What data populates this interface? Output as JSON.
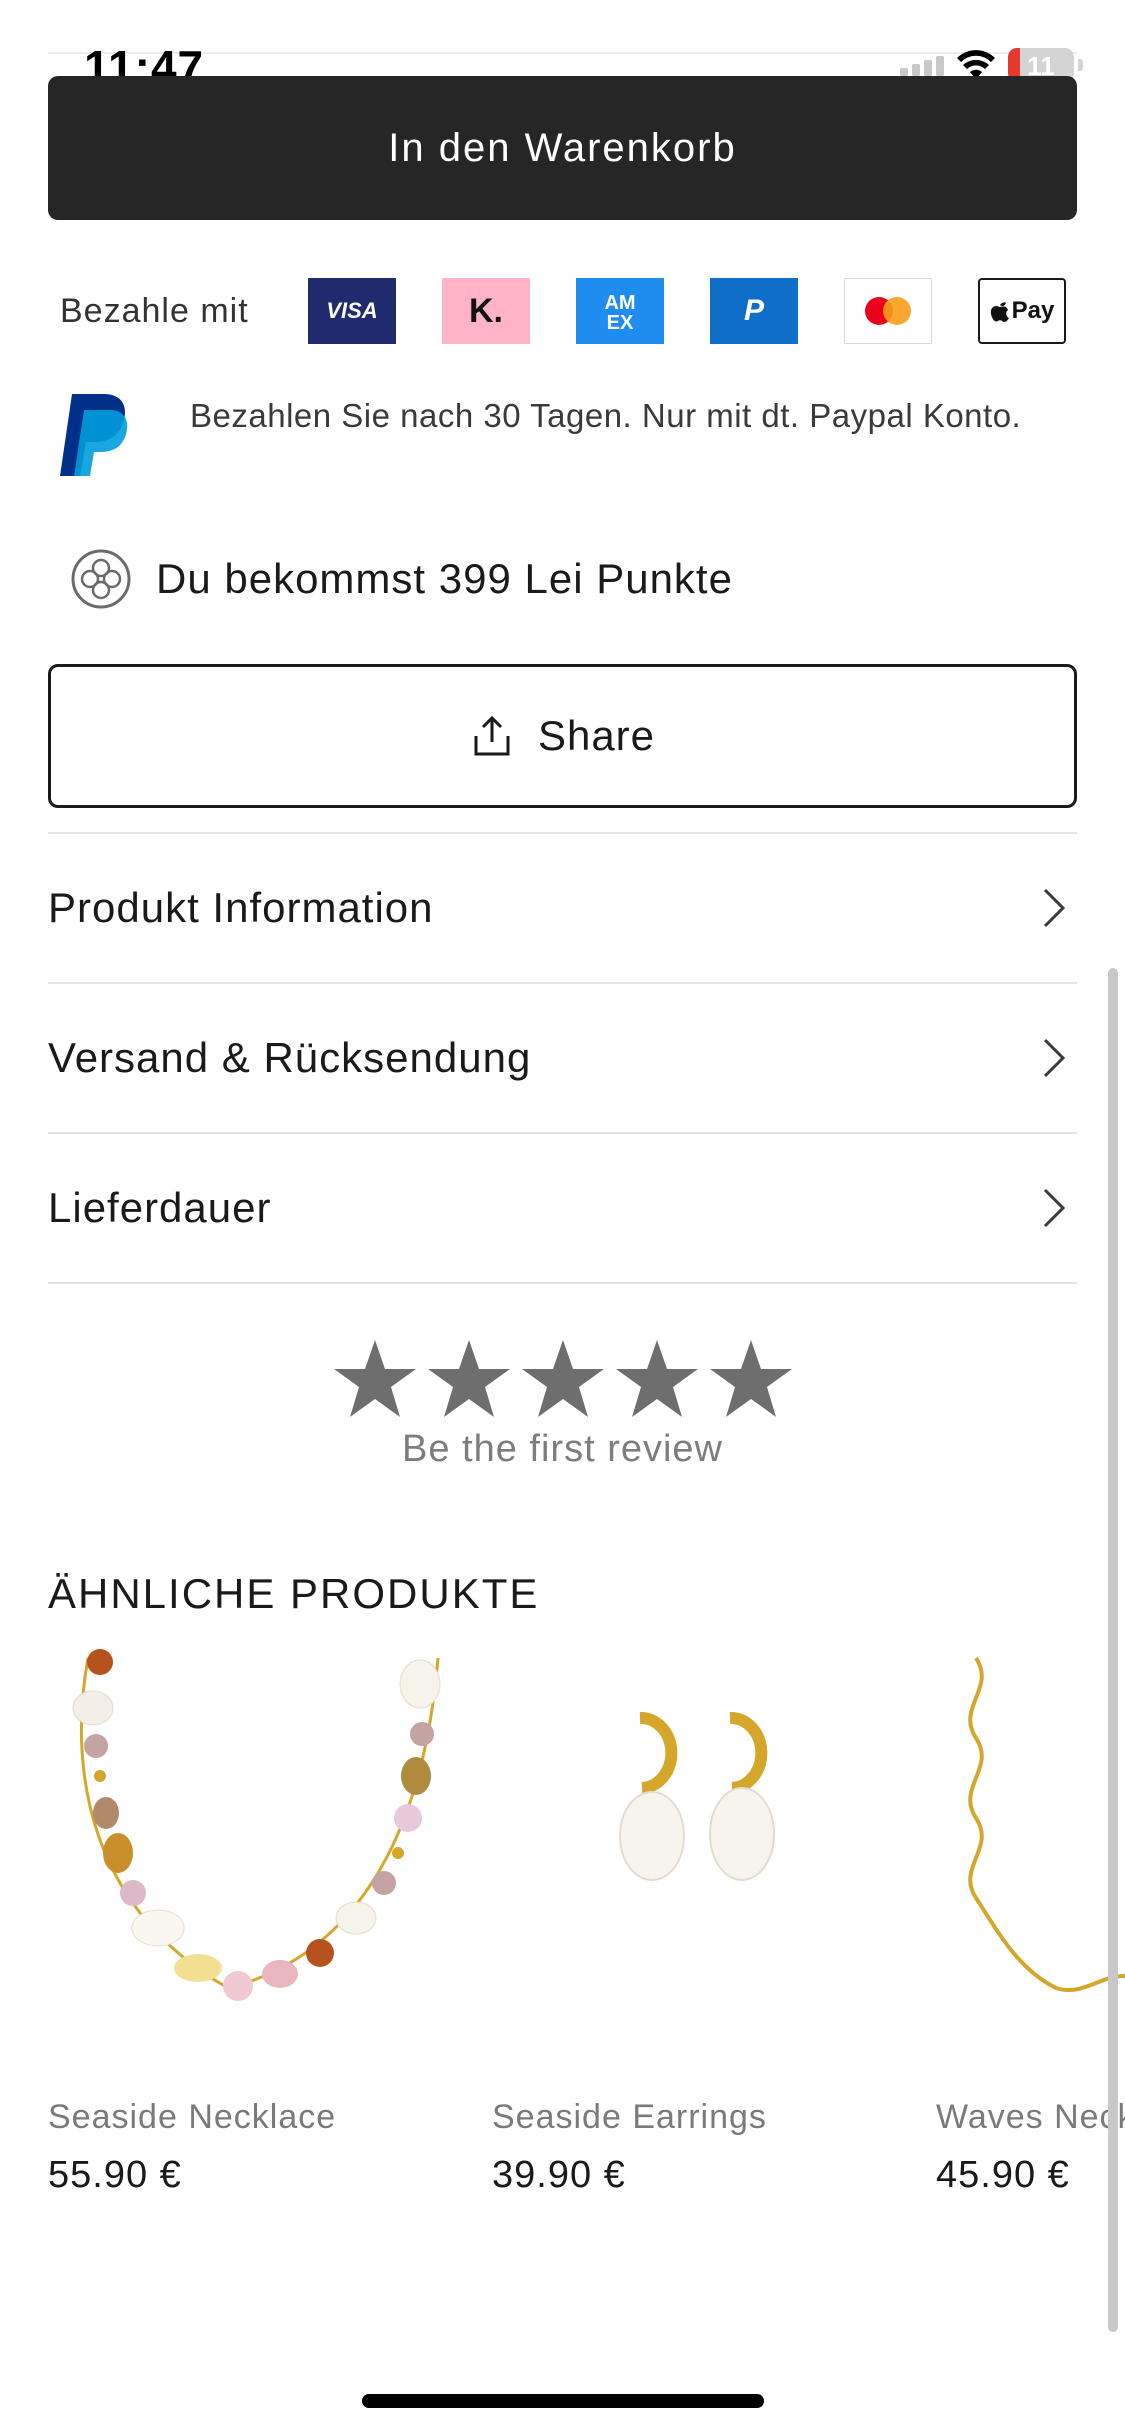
{
  "status_bar": {
    "time": "11:47",
    "battery": "11"
  },
  "cart_button": {
    "label": "In den Warenkorb"
  },
  "payment": {
    "label": "Bezahle mit",
    "methods": [
      {
        "name": "visa",
        "text": "VISA",
        "color": "#1f2b6c"
      },
      {
        "name": "klarna",
        "text": "K.",
        "color": "#ffb3c7"
      },
      {
        "name": "amex",
        "text": "AM EX",
        "color": "#1f8df0"
      },
      {
        "name": "paypal",
        "text": "P",
        "color": "#0f6fc8"
      },
      {
        "name": "mastercard",
        "text": "",
        "color": "#eb001b"
      },
      {
        "name": "apple-pay",
        "text": "Pay",
        "color": "#111111"
      }
    ]
  },
  "paypal_info": {
    "text": "Bezahlen Sie nach 30 Tagen. Nur mit dt. Paypal Konto."
  },
  "points": {
    "text": "Du bekommst 399 Lei Punkte",
    "icon": "points-icon"
  },
  "share": {
    "label": "Share",
    "icon": "share-icon"
  },
  "accordion": [
    {
      "label": "Produkt Information"
    },
    {
      "label": "Versand & Rücksendung"
    },
    {
      "label": "Lieferdauer"
    }
  ],
  "rating": {
    "stars": 5,
    "filled": 0,
    "text": "Be the first review",
    "star_color": "#6e6e6e"
  },
  "similar": {
    "title": "ÄHNLICHE PRODUKTE",
    "products": [
      {
        "name": "Seaside Necklace",
        "price": "55.90 €"
      },
      {
        "name": "Seaside Earrings",
        "price": "39.90 €"
      },
      {
        "name": "Waves Necklace",
        "price": "45.90 €"
      }
    ]
  },
  "colors": {
    "button_dark": "#262626",
    "text": "#1a1a1a",
    "muted": "#7a7a7a",
    "gold": "#d4a62a"
  }
}
